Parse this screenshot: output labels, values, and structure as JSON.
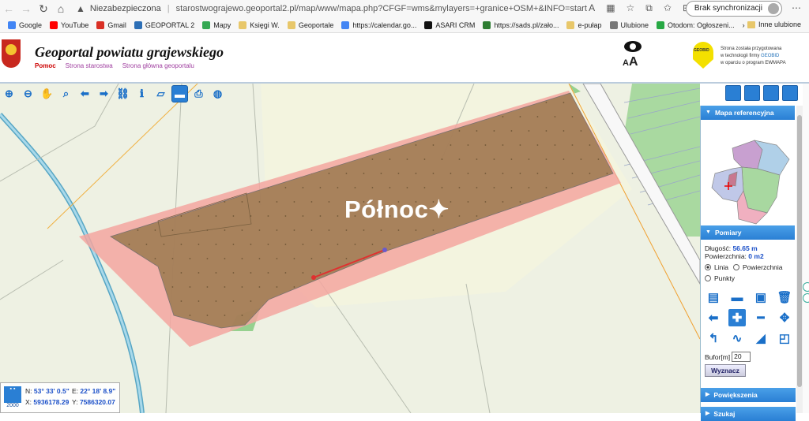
{
  "browser": {
    "security_label": "Niezabezpieczona",
    "url": "starostwograjewo.geoportal2.pl/map/www/mapa.php?CFGF=wms&mylayers=+granice+OSM+&INFO=start",
    "sync_label": "Brak synchronizacji",
    "bookmarks": [
      {
        "label": "Google",
        "color": "#4285f4"
      },
      {
        "label": "YouTube",
        "color": "#ff0000"
      },
      {
        "label": "Gmail",
        "color": "#d93025"
      },
      {
        "label": "GEOPORTAL 2",
        "color": "#2d6fb6"
      },
      {
        "label": "Mapy",
        "color": "#34a853"
      },
      {
        "label": "Księgi W.",
        "color": "#e8c76a"
      },
      {
        "label": "Geoportale",
        "color": "#e8c76a"
      },
      {
        "label": "https://calendar.go...",
        "color": "#4285f4"
      },
      {
        "label": "ASARI CRM",
        "color": "#111111"
      },
      {
        "label": "https://sads.pl/zało...",
        "color": "#2e7d32"
      },
      {
        "label": "e-pułap",
        "color": "#e8c76a"
      },
      {
        "label": "Ulubione",
        "color": "#777777"
      },
      {
        "label": "Otodom: Ogłoszeni...",
        "color": "#27a844"
      }
    ],
    "other_favorites": "Inne ulubione"
  },
  "header": {
    "title": "Geoportal powiatu grajewskiego",
    "links": [
      "Pomoc",
      "Strona starostwa",
      "Strona główna geoportalu"
    ],
    "font_size_icon": "AA",
    "geobid_badge": "GEOBID",
    "note_line1": "Strona została przygotowana",
    "note_line2_prefix": "w technologii firmy ",
    "note_line2_brand": "GEOBID",
    "note_line3": "w oparciu o program EWMAPA"
  },
  "toolbar": {
    "tools": [
      "zoom-in-icon",
      "zoom-out-icon",
      "pan-hand-icon",
      "zoom-window-icon",
      "back-arrow-icon",
      "forward-arrow-icon",
      "link-icon",
      "info-icon",
      "legend-icon",
      "measure-ruler-icon",
      "print-icon",
      "globe-icon"
    ],
    "selected": "measure-ruler-icon"
  },
  "map": {
    "watermark": "Północ",
    "parcel_color": "#9b7a4f",
    "buffer_color": "#f3a6a0",
    "forest_color": "#8fcf8a"
  },
  "coords": {
    "scale": "2000",
    "n_label": "N:",
    "n_value": "53° 33' 0.5\"",
    "e_label": "E:",
    "e_value": "22° 18' 8.9\"",
    "x_label": "X:",
    "x_value": "5936178.29",
    "y_label": "Y:",
    "y_value": "7586320.07"
  },
  "panel": {
    "reference_map": "Mapa referencyjna",
    "measurements": "Pomiary",
    "length_label": "Długość:",
    "length_value": "56.65 m",
    "area_label": "Powierzchnia:",
    "area_value": "0 m2",
    "mode_line": "Linia",
    "mode_area": "Powierzchnia",
    "mode_points": "Punkty",
    "buffer_label": "Bufor[m]",
    "buffer_value": "20",
    "calc_button": "Wyznacz",
    "zoom_section": "Powiększenia",
    "last_section": "Szukaj"
  }
}
